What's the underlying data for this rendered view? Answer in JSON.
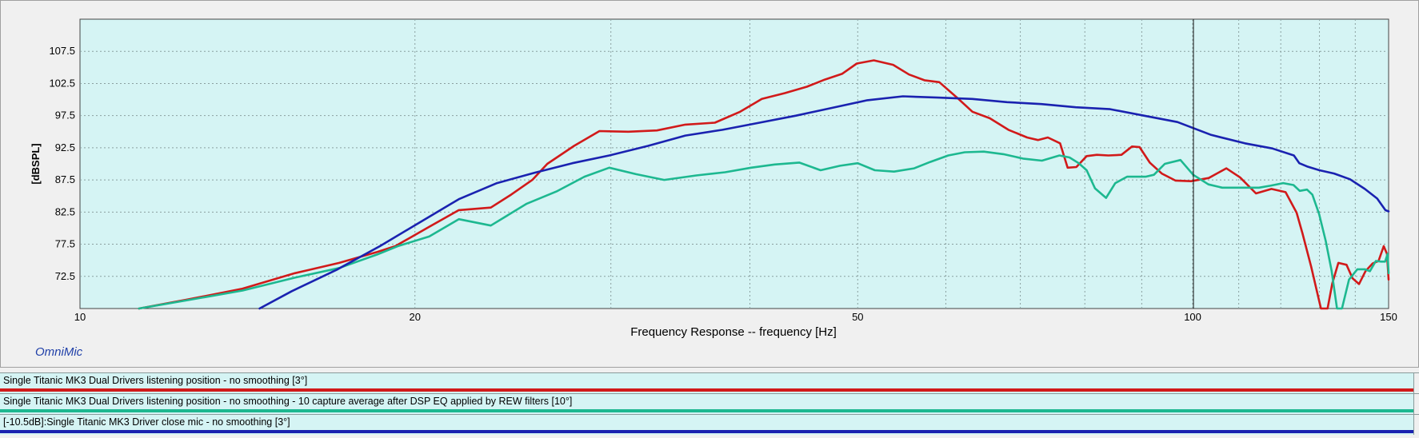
{
  "chart_data": {
    "type": "line",
    "xlabel": "Frequency Response -- frequency [Hz]",
    "ylabel": "[dBSPL]",
    "x_scale": "log",
    "xlim": [
      10,
      150
    ],
    "ylim": [
      67.5,
      112.5
    ],
    "x_ticks": [
      10,
      20,
      50,
      100,
      150
    ],
    "x_tick_labels": [
      "10",
      "20",
      "50",
      "100",
      "150"
    ],
    "y_ticks": [
      72.5,
      77.5,
      82.5,
      87.5,
      92.5,
      97.5,
      102.5,
      107.5
    ],
    "y_tick_labels": [
      "72.5",
      "77.5",
      "82.5",
      "87.5",
      "92.5",
      "97.5",
      "102.5",
      "107.5"
    ],
    "grid": true,
    "series": [
      {
        "name": "Single Titanic MK3 Dual Drivers listening position - no smoothing [3°]",
        "color": "#d11a1a",
        "x": [
          11.3,
          12.5,
          14.0,
          15.6,
          17.1,
          18.5,
          19.2,
          20.6,
          21.9,
          23.4,
          24.4,
          25.5,
          26.3,
          27.8,
          29.3,
          31.1,
          33.0,
          35.0,
          37.2,
          39.2,
          41.0,
          43.0,
          45.0,
          46.7,
          48.4,
          49.9,
          51.7,
          53.8,
          55.6,
          57.4,
          59.2,
          61.4,
          63.4,
          65.7,
          68.3,
          71.0,
          72.6,
          74.1,
          76.0,
          77.2,
          78.6,
          80.3,
          82.0,
          84.0,
          86.3,
          88.2,
          89.6,
          91.5,
          93.8,
          96.5,
          99.7,
          103.4,
          107.2,
          110.3,
          114.0,
          117.7,
          121.2,
          124.0,
          125.5,
          127.8,
          130.4,
          132.2,
          133.5,
          135.2,
          137.5,
          139.2,
          141.1,
          143.0,
          145.1,
          146.9,
          148.5,
          149.5,
          150.0
        ],
        "y": [
          67.5,
          68.9,
          70.6,
          73.0,
          74.6,
          76.3,
          77.2,
          80.2,
          82.8,
          83.2,
          85.2,
          87.5,
          90.0,
          92.8,
          95.1,
          95.0,
          95.2,
          96.1,
          96.4,
          98.1,
          100.1,
          101.0,
          102.0,
          103.1,
          104.0,
          105.6,
          106.1,
          105.4,
          103.9,
          103.0,
          102.7,
          100.3,
          98.1,
          97.1,
          95.3,
          94.1,
          93.7,
          94.1,
          93.2,
          89.4,
          89.5,
          91.2,
          91.4,
          91.3,
          91.4,
          92.7,
          92.6,
          90.2,
          88.5,
          87.4,
          87.3,
          87.8,
          89.3,
          87.9,
          85.4,
          86.1,
          85.6,
          82.4,
          79.2,
          74.0,
          67.5,
          67.5,
          71.4,
          74.6,
          74.3,
          72.2,
          71.3,
          73.3,
          74.5,
          74.9,
          77.2,
          76.0,
          72.0
        ]
      },
      {
        "name": "Single Titanic MK3 Dual Drivers listening position - no smoothing - 10 capture average after DSP EQ applied by REW filters [10°]",
        "color": "#1db890",
        "x": [
          11.3,
          12.5,
          14.0,
          15.6,
          17.1,
          18.5,
          19.3,
          20.6,
          21.9,
          23.4,
          25.2,
          26.8,
          28.4,
          29.9,
          31.6,
          33.5,
          35.8,
          38.0,
          40.1,
          42.1,
          44.3,
          46.3,
          48.2,
          50.0,
          51.8,
          53.9,
          56.2,
          58.1,
          60.3,
          62.4,
          64.9,
          67.6,
          70.5,
          73.2,
          75.9,
          77.5,
          79.0,
          80.3,
          81.7,
          83.6,
          85.2,
          87.3,
          89.4,
          90.7,
          92.3,
          94.4,
          97.5,
          100.1,
          103.3,
          106.3,
          109.1,
          112.1,
          114.7,
          117.4,
          120.6,
          123.2,
          124.8,
          126.7,
          128.1,
          129.9,
          131.7,
          133.3,
          134.8,
          136.2,
          138.2,
          140.6,
          142.8,
          144.3,
          146.1,
          147.7,
          148.9,
          149.7,
          150.0
        ],
        "y": [
          67.5,
          68.8,
          70.3,
          72.3,
          73.8,
          75.9,
          77.2,
          78.7,
          81.4,
          80.4,
          83.8,
          85.7,
          88.0,
          89.4,
          88.4,
          87.5,
          88.2,
          88.7,
          89.4,
          89.9,
          90.2,
          89.0,
          89.7,
          90.1,
          89.0,
          88.8,
          89.3,
          90.3,
          91.3,
          91.8,
          91.9,
          91.5,
          90.8,
          90.5,
          91.3,
          91.0,
          90.1,
          89.0,
          86.2,
          84.7,
          87.0,
          88.0,
          88.0,
          88.0,
          88.3,
          90.0,
          90.6,
          88.3,
          86.8,
          86.3,
          86.3,
          86.3,
          86.3,
          86.6,
          87.0,
          86.7,
          85.8,
          86.0,
          85.2,
          82.2,
          78.0,
          73.4,
          67.5,
          67.5,
          72.0,
          73.6,
          73.6,
          73.3,
          74.9,
          74.8,
          74.8,
          76.0,
          73.0
        ]
      },
      {
        "name": "[-10.5dB]:Single Titanic MK3 Driver close mic - no smoothing [3°]",
        "color": "#1a22b0",
        "x": [
          14.5,
          15.5,
          17.0,
          18.6,
          20.2,
          21.9,
          23.7,
          25.6,
          27.7,
          29.9,
          32.4,
          35.0,
          37.8,
          40.8,
          44.0,
          47.4,
          51.0,
          54.9,
          59.0,
          63.4,
          68.1,
          73.1,
          78.5,
          84.3,
          90.4,
          96.9,
          103.9,
          111.4,
          117.9,
          123.3,
          124.7,
          126.7,
          130.0,
          134.0,
          138.5,
          142.8,
          146.5,
          149.0,
          150.0
        ],
        "y": [
          67.5,
          70.2,
          73.5,
          77.2,
          80.9,
          84.5,
          87.0,
          88.6,
          90.1,
          91.3,
          92.8,
          94.4,
          95.3,
          96.4,
          97.5,
          98.7,
          99.9,
          100.5,
          100.3,
          100.1,
          99.6,
          99.3,
          98.8,
          98.5,
          97.5,
          96.5,
          94.5,
          93.2,
          92.4,
          91.3,
          90.1,
          89.6,
          89.0,
          88.5,
          87.6,
          86.1,
          84.6,
          82.8,
          82.6
        ]
      }
    ]
  },
  "brand": "OmniMic",
  "legend": [
    {
      "label": "Single Titanic MK3 Dual Drivers listening position - no smoothing [3°]",
      "color": "#d11a1a"
    },
    {
      "label": "Single Titanic MK3 Dual Drivers listening position - no smoothing -  10 capture average after DSP EQ applied by REW filters [10°]",
      "color": "#1db890"
    },
    {
      "label": "[-10.5dB]:Single Titanic MK3 Driver close mic - no smoothing [3°]",
      "color": "#1a22b0"
    }
  ]
}
